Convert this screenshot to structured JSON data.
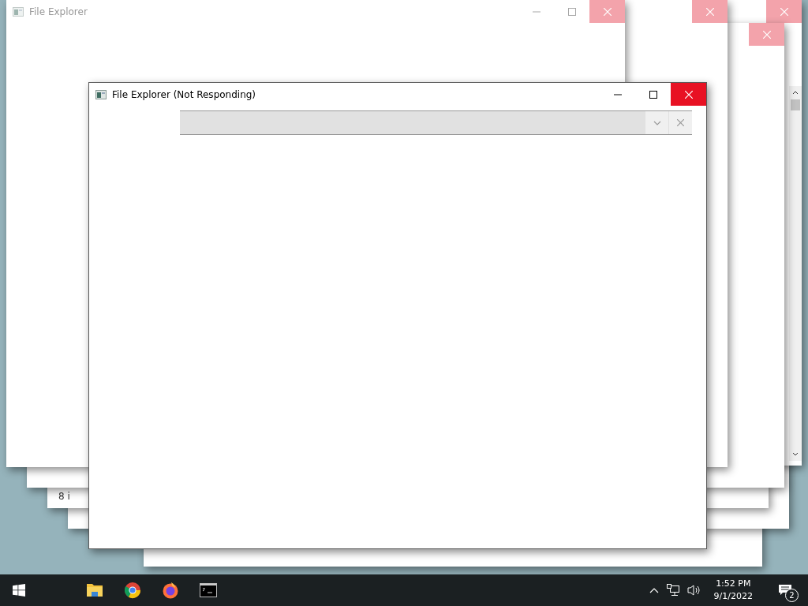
{
  "desktop": {
    "windows": [
      {
        "kind": "ghost"
      },
      {
        "kind": "ghost"
      },
      {
        "kind": "ghost",
        "status": "8 i"
      },
      {
        "kind": "ghost",
        "scrollbar": true,
        "close_button": true
      },
      {
        "kind": "ghost",
        "close_button": true
      },
      {
        "kind": "ghost",
        "close_button": true
      },
      {
        "kind": "ghost",
        "title": "File Explorer",
        "close_button": true
      },
      {
        "kind": "active",
        "title": "File Explorer (Not Responding)",
        "close_button": true
      }
    ]
  },
  "taskbar": {
    "apps": [
      {
        "kind": "folder"
      },
      {
        "kind": "chrome"
      },
      {
        "kind": "firefox"
      },
      {
        "kind": "terminal"
      }
    ],
    "time": "1:52 PM",
    "date": "9/1/2022",
    "notifications": "2"
  }
}
